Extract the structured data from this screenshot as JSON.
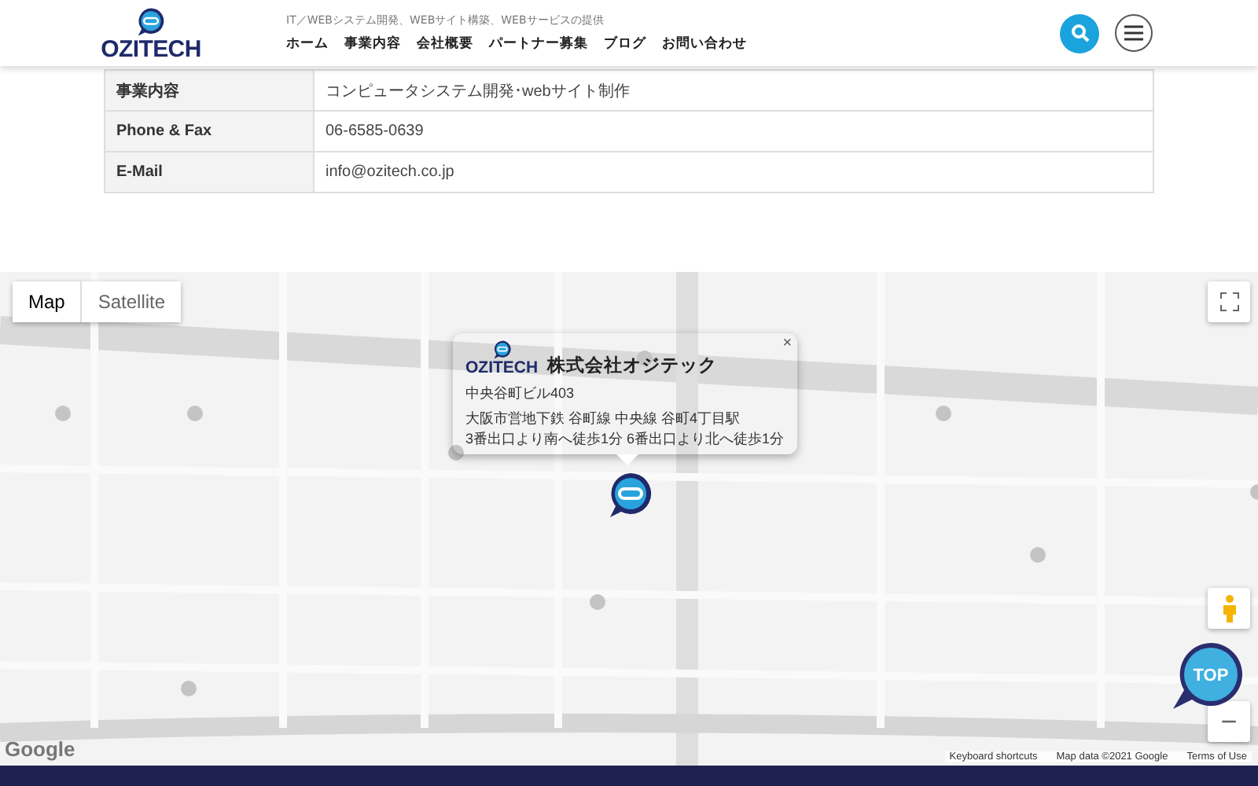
{
  "header": {
    "logo": "OZITECH",
    "tagline": "IT／WEBシステム開発、WEBサイト構築、WEBサービスの提供",
    "nav": [
      {
        "label": "ホーム"
      },
      {
        "label": "事業内容"
      },
      {
        "label": "会社概要"
      },
      {
        "label": "パートナー募集"
      },
      {
        "label": "ブログ"
      },
      {
        "label": "お問い合わせ"
      }
    ]
  },
  "company_table": {
    "rows": [
      {
        "label": "事業内容",
        "value": "コンピュータシステム開発･webサイト制作"
      },
      {
        "label": "Phone & Fax",
        "value": "06-6585-0639"
      },
      {
        "label": "E-Mail",
        "value": "info@ozitech.co.jp"
      }
    ]
  },
  "map": {
    "map_types": [
      {
        "label": "Map",
        "selected": true
      },
      {
        "label": "Satellite",
        "selected": false
      }
    ],
    "info_window": {
      "logo": "OZITECH",
      "title": "株式会社オジテック",
      "close": "×",
      "address": "中央谷町ビル403",
      "access": [
        "大阪市営地下鉄 谷町線 中央線 谷町4丁目駅",
        "3番出口より南へ徒歩1分 6番出口より北へ徒歩1分"
      ]
    },
    "zoom_out": "−",
    "google_logo": "Google",
    "attribution": [
      "Keyboard shortcuts",
      "Map data ©2021 Google",
      "Terms of Use"
    ]
  },
  "top_button": "TOP"
}
